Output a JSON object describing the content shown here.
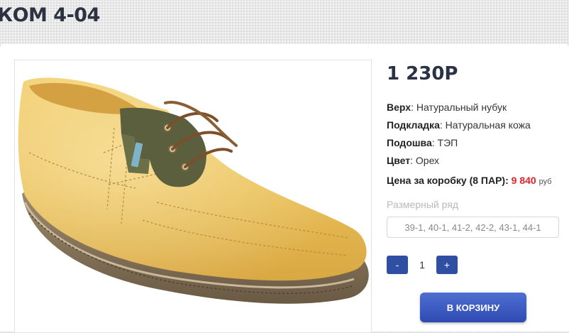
{
  "product": {
    "title": "КОМ 4-04",
    "price": "1 230Р",
    "specs": [
      {
        "label": "Верх",
        "value": "Натуральный нубук"
      },
      {
        "label": "Подкладка",
        "value": "Натуральная кожа"
      },
      {
        "label": "Подошва",
        "value": "ТЭП"
      },
      {
        "label": "Цвет",
        "value": "Орех"
      }
    ],
    "box_price_label": "Цена за коробку (8 ПАР):",
    "box_price_value": "9 840",
    "box_price_unit": "руб",
    "sizes_label": "Размерный ряд",
    "sizes_value": "39-1, 40-1, 41-2, 42-2, 43-1, 44-1"
  },
  "quantity": {
    "minus_label": "-",
    "value": "1",
    "plus_label": "+"
  },
  "cart": {
    "button_label": "В КОРЗИНУ"
  },
  "colors": {
    "accent": "#2f4fa3",
    "price_highlight": "#e0242b",
    "heading": "#2b3245"
  },
  "image": {
    "subject": "yellow nubuck lace-up shoe with olive green lace panel"
  }
}
